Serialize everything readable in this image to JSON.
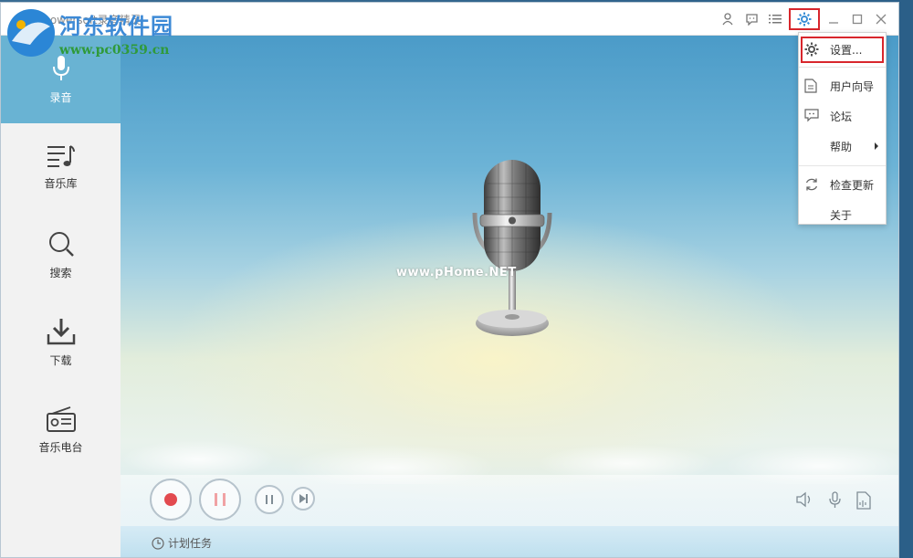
{
  "window": {
    "app_title": "Apowersoft录音精灵"
  },
  "watermark": {
    "site_name": "河东软件园",
    "url": "www.pc0359.cn",
    "image_mark": "www.pHome.NET"
  },
  "titlebar": {
    "icons": [
      "user-icon",
      "chat-icon",
      "list-icon",
      "gear-icon",
      "minimize-icon",
      "maximize-icon",
      "close-icon"
    ]
  },
  "sidebar": {
    "items": [
      {
        "label": "录音",
        "icon": "microphone-icon",
        "active": true
      },
      {
        "label": "音乐库",
        "icon": "music-list-icon",
        "active": false
      },
      {
        "label": "搜索",
        "icon": "search-icon",
        "active": false
      },
      {
        "label": "下载",
        "icon": "download-icon",
        "active": false
      },
      {
        "label": "音乐电台",
        "icon": "radio-icon",
        "active": false
      }
    ]
  },
  "menu": {
    "items": [
      {
        "label": "设置...",
        "icon": "gear-icon"
      },
      {
        "label": "用户向导",
        "icon": "document-icon"
      },
      {
        "label": "论坛",
        "icon": "chat-icon"
      },
      {
        "label": "帮助",
        "icon": "",
        "submenu": true
      },
      {
        "label": "检查更新",
        "icon": "refresh-icon"
      },
      {
        "label": "关于",
        "icon": ""
      }
    ]
  },
  "statusbar": {
    "plan_task": "计划任务"
  },
  "colors": {
    "sidebar_active": "#69b3d3",
    "highlight_border": "#d8262c",
    "record_red": "#e24a4f"
  }
}
